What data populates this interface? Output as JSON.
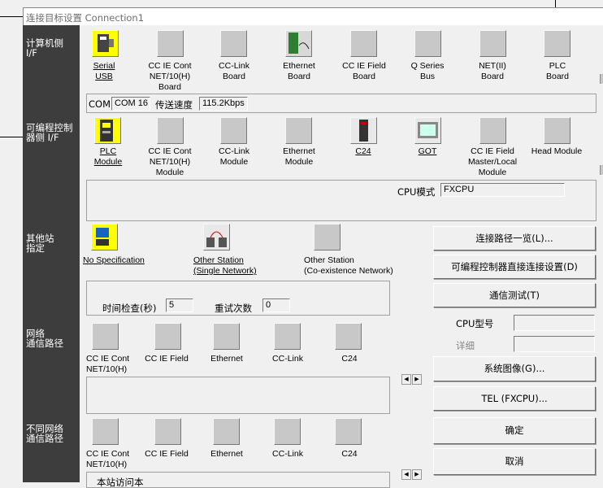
{
  "window": {
    "title": "连接目标设置 Connection1"
  },
  "sidebar": {
    "pc_if": "计算机侧\nI/F",
    "plc_if": "可编程控制\n器侧 I/F",
    "other_station": "其他站\n指定",
    "network_route": "网络\n通信路径",
    "coexist_route": "不同网络\n通信路径"
  },
  "pc_if": {
    "items": [
      {
        "label": "Serial\nUSB",
        "selected": true,
        "icon": "serial-usb-icon"
      },
      {
        "label": "CC IE Cont\nNET/10(H)\nBoard",
        "icon": "board-icon"
      },
      {
        "label": "CC-Link\nBoard",
        "icon": "board-icon"
      },
      {
        "label": "Ethernet\nBoard",
        "icon": "ethernet-board-icon"
      },
      {
        "label": "CC IE Field\nBoard",
        "icon": "board-icon"
      },
      {
        "label": "Q Series\nBus",
        "icon": "bus-icon"
      },
      {
        "label": "NET(II)\nBoard",
        "icon": "board-icon"
      },
      {
        "label": "PLC\nBoard",
        "icon": "board-icon"
      }
    ],
    "com_label": "COM",
    "com_value": "COM 16",
    "speed_label": "传送速度",
    "speed_value": "115.2Kbps"
  },
  "plc_if": {
    "items": [
      {
        "label": "PLC\nModule",
        "selected": true,
        "icon": "plc-module-icon"
      },
      {
        "label": "CC IE Cont\nNET/10(H)\nModule",
        "icon": "module-icon"
      },
      {
        "label": "CC-Link\nModule",
        "icon": "module-icon"
      },
      {
        "label": "Ethernet\nModule",
        "icon": "module-icon"
      },
      {
        "label": "C24",
        "icon": "c24-icon"
      },
      {
        "label": "GOT",
        "icon": "got-icon"
      },
      {
        "label": "CC IE Field\nMaster/Local\nModule",
        "icon": "module-icon"
      },
      {
        "label": "Head Module",
        "icon": "module-icon"
      }
    ],
    "cpu_mode_label": "CPU模式",
    "cpu_mode_value": "FXCPU"
  },
  "other_station": {
    "items": [
      {
        "label": "No Specification",
        "selected": true,
        "icon": "no-spec-icon"
      },
      {
        "label": "Other Station\n(Single Network)",
        "icon": "network-icon"
      },
      {
        "label": "Other Station\n(Co-existence Network)",
        "icon": "station-icon"
      }
    ],
    "timeout_label": "时间检查(秒)",
    "timeout_value": "5",
    "retry_label": "重试次数",
    "retry_value": "0"
  },
  "network_route": {
    "items": [
      {
        "label": "CC IE Cont\nNET/10(H)"
      },
      {
        "label": "CC IE Field"
      },
      {
        "label": "Ethernet"
      },
      {
        "label": "CC-Link"
      },
      {
        "label": "C24"
      }
    ]
  },
  "coexist_route": {
    "items": [
      {
        "label": "CC IE Cont\nNET/10(H)"
      },
      {
        "label": "CC IE Field"
      },
      {
        "label": "Ethernet"
      },
      {
        "label": "CC-Link"
      },
      {
        "label": "C24"
      }
    ],
    "partial_text": "本站访问本"
  },
  "buttons": {
    "route_list": "连接路径一览(L)...",
    "direct_connect": "可编程控制器直接连接设置(D)",
    "comm_test": "通信测试(T)",
    "system_image": "系统图像(G)...",
    "tel": "TEL (FXCPU)...",
    "ok": "确定",
    "cancel": "取消"
  },
  "info": {
    "cpu_type_label": "CPU型号",
    "detail_label": "详细"
  }
}
